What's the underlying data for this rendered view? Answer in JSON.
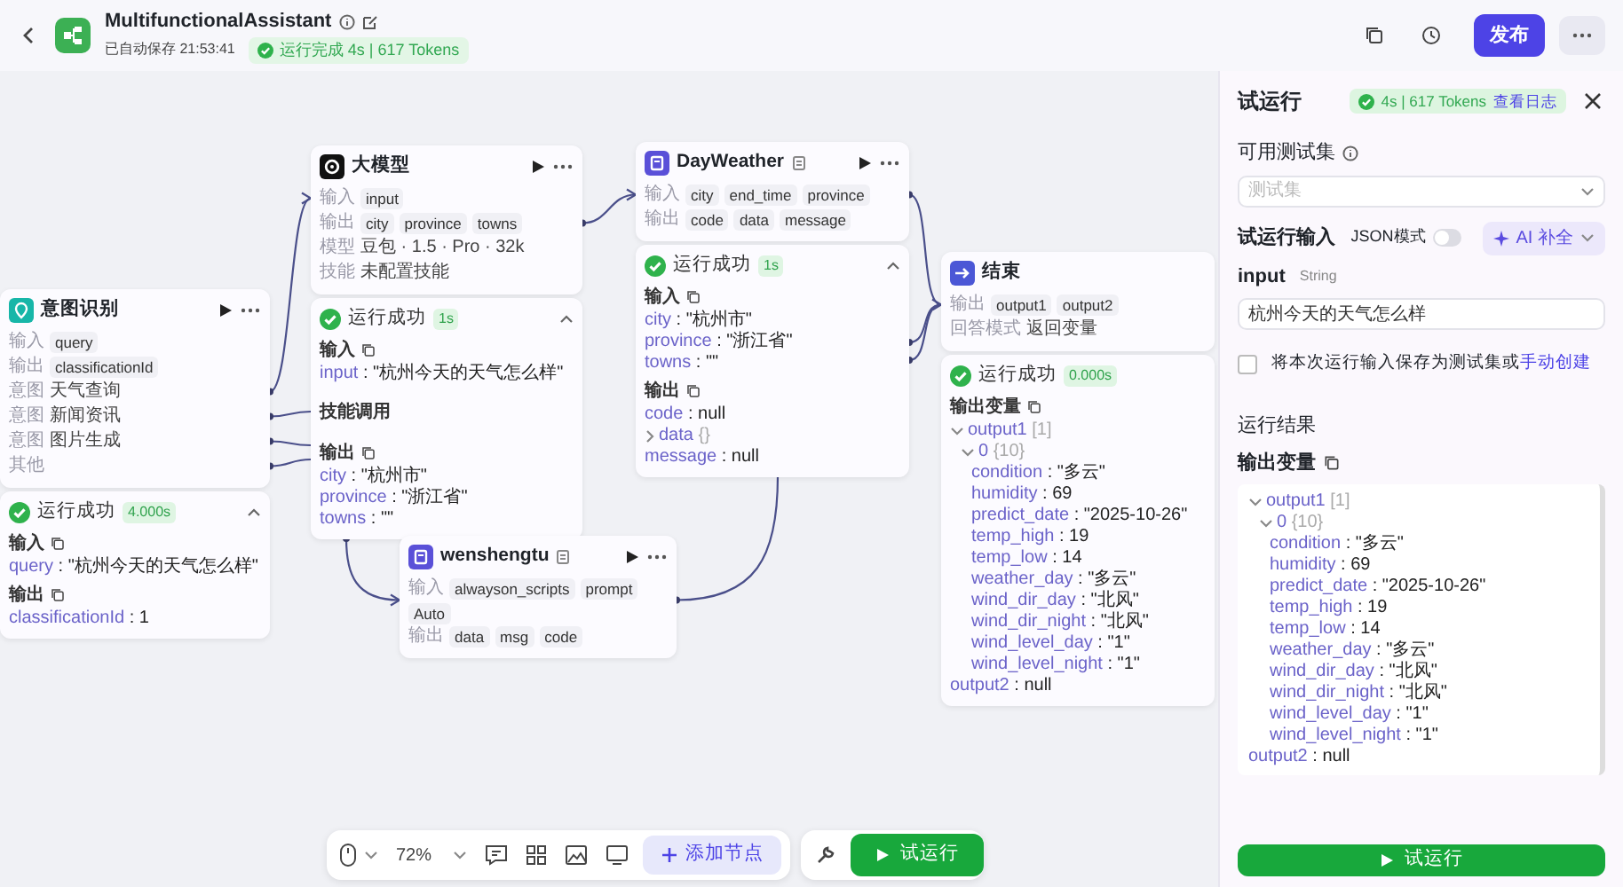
{
  "header": {
    "app_name": "MultifunctionalAssistant",
    "saved": "已自动保存 21:53:41",
    "run_status": "运行完成 4s | 617 Tokens",
    "publish": "发布"
  },
  "nodes": [
    {
      "kind": "intent",
      "title": "意图识别",
      "rows": [
        {
          "label": "输入",
          "tags": [
            "query"
          ]
        },
        {
          "label": "输出",
          "tags": [
            "classificationId"
          ]
        },
        {
          "label": "意图",
          "text": "天气查询"
        },
        {
          "label": "意图",
          "text": "新闻资讯"
        },
        {
          "label": "意图",
          "text": "图片生成"
        },
        {
          "label": "其他"
        }
      ],
      "result": {
        "status": "运行成功",
        "time": "4.000s",
        "expanded": true,
        "sections": [
          {
            "kind": "io",
            "title": "输入",
            "lines": [
              {
                "key": "query",
                "value": ": \"杭州今天的天气怎么样\""
              }
            ]
          },
          {
            "kind": "io",
            "title": "输出",
            "lines": [
              {
                "key": "classificationId",
                "value": ": 1"
              }
            ]
          }
        ]
      }
    },
    {
      "kind": "llm",
      "title": "大模型",
      "rows": [
        {
          "label": "输入",
          "tags": [
            "input"
          ]
        },
        {
          "label": "输出",
          "tags": [
            "city",
            "province",
            "towns"
          ]
        },
        {
          "label": "模型",
          "text": "豆包 · 1.5 · Pro · 32k"
        },
        {
          "label": "技能",
          "text": "未配置技能"
        }
      ],
      "result": {
        "status": "运行成功",
        "time": "1s",
        "expanded": true,
        "sections": [
          {
            "kind": "io",
            "title": "输入",
            "lines": [
              {
                "key": "input",
                "value": ": \"杭州今天的天气怎么样\""
              }
            ]
          },
          {
            "kind": "label",
            "title": "技能调用"
          },
          {
            "kind": "io",
            "title": "输出",
            "lines": [
              {
                "key": "city",
                "value": ": \"杭州市\""
              },
              {
                "key": "province",
                "value": ": \"浙江省\""
              },
              {
                "key": "towns",
                "value": ": \"\""
              }
            ]
          }
        ]
      }
    },
    {
      "kind": "plugin",
      "title": "DayWeather",
      "rows": [
        {
          "label": "输入",
          "tags": [
            "city",
            "end_time",
            "province"
          ]
        },
        {
          "label": "输出",
          "tags": [
            "code",
            "data",
            "message"
          ]
        }
      ],
      "result": {
        "status": "运行成功",
        "time": "1s",
        "expanded": true,
        "sections": [
          {
            "kind": "io",
            "title": "输入",
            "lines": [
              {
                "key": "city",
                "value": ": \"杭州市\""
              },
              {
                "key": "province",
                "value": ": \"浙江省\""
              },
              {
                "key": "towns",
                "value": ": \"\""
              }
            ]
          },
          {
            "kind": "io",
            "title": "输出",
            "lines": [
              {
                "key": "code",
                "value": ": null"
              },
              {
                "key": "data",
                "count": "{}",
                "expanded": false
              },
              {
                "key": "message",
                "value": ": null"
              }
            ]
          }
        ]
      }
    },
    {
      "kind": "end",
      "title": "结束",
      "rows": [
        {
          "label": "输出",
          "tags": [
            "output1",
            "output2"
          ]
        },
        {
          "label": "回答模式",
          "text": "返回变量"
        }
      ],
      "result": {
        "status": "运行成功",
        "time": "0.000s",
        "sections": [
          {
            "kind": "io",
            "title": "输出变量",
            "lines": [
              {
                "key": "output1",
                "count": "[1]",
                "expanded": true,
                "children": [
                  {
                    "key": "0",
                    "count": "{10}",
                    "expanded": true,
                    "children": [
                      {
                        "key": "condition",
                        "value": ": \"多云\""
                      },
                      {
                        "key": "humidity",
                        "value": ": 69"
                      },
                      {
                        "key": "predict_date",
                        "value": ": \"2025-10-26\""
                      },
                      {
                        "key": "temp_high",
                        "value": ": 19"
                      },
                      {
                        "key": "temp_low",
                        "value": ": 14"
                      },
                      {
                        "key": "weather_day",
                        "value": ": \"多云\""
                      },
                      {
                        "key": "wind_dir_day",
                        "value": ": \"北风\""
                      },
                      {
                        "key": "wind_dir_night",
                        "value": ": \"北风\""
                      },
                      {
                        "key": "wind_level_day",
                        "value": ": \"1\""
                      },
                      {
                        "key": "wind_level_night",
                        "value": ": \"1\""
                      }
                    ]
                  }
                ]
              },
              {
                "key": "output2",
                "value": ": null"
              }
            ]
          }
        ]
      }
    },
    {
      "kind": "plugin",
      "title": "wenshengtu",
      "rows": [
        {
          "label": "输入",
          "tags": [
            "alwayson_scripts",
            "prompt",
            "Auto"
          ]
        },
        {
          "label": "输出",
          "tags": [
            "data",
            "msg",
            "code"
          ]
        }
      ]
    }
  ],
  "toolbar": {
    "zoom": "72%",
    "add_node": "添加节点",
    "run": "试运行"
  },
  "panel": {
    "title": "试运行",
    "stats": "4s | 617 Tokens",
    "log_link": "查看日志",
    "testset_label": "可用测试集",
    "testset_placeholder": "测试集",
    "input_title": "试运行输入",
    "json_mode": {
      "label": "JSON模式",
      "on": false
    },
    "ai_button": "AI 补全",
    "input": {
      "name": "input",
      "type": "String",
      "value": "杭州今天的天气怎么样"
    },
    "save": {
      "text": "将本次运行输入保存为测试集或",
      "link": "手动创建",
      "checked": false
    },
    "result_title": "运行结果",
    "output_title": "输出变量",
    "tree": [
      {
        "key": "output1",
        "count": "[1]",
        "expanded": true,
        "children": [
          {
            "key": "0",
            "count": "{10}",
            "expanded": true,
            "children": [
              {
                "key": "condition",
                "value": ": \"多云\""
              },
              {
                "key": "humidity",
                "value": ": 69"
              },
              {
                "key": "predict_date",
                "value": ": \"2025-10-26\""
              },
              {
                "key": "temp_high",
                "value": ": 19"
              },
              {
                "key": "temp_low",
                "value": ": 14"
              },
              {
                "key": "weather_day",
                "value": ": \"多云\""
              },
              {
                "key": "wind_dir_day",
                "value": ": \"北风\""
              },
              {
                "key": "wind_dir_night",
                "value": ": \"北风\""
              },
              {
                "key": "wind_level_day",
                "value": ": \"1\""
              },
              {
                "key": "wind_level_night",
                "value": ": \"1\""
              }
            ]
          }
        ]
      },
      {
        "key": "output2",
        "value": ": null"
      }
    ],
    "run": "试运行"
  }
}
